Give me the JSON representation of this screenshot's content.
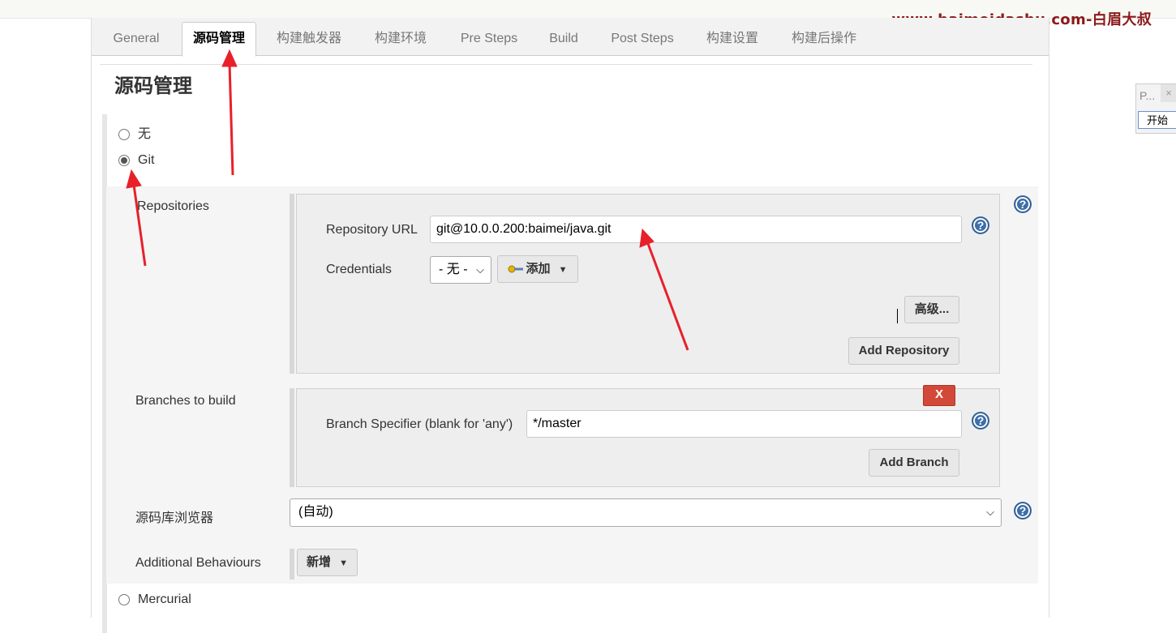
{
  "watermark": "www.baimeidashu.com-白眉大叔",
  "tabs": [
    "General",
    "源码管理",
    "构建触发器",
    "构建环境",
    "Pre Steps",
    "Build",
    "Post Steps",
    "构建设置",
    "构建后操作"
  ],
  "active_tab_index": 1,
  "section_title": "源码管理",
  "scm_options": {
    "none": "无",
    "git": "Git",
    "mercurial": "Mercurial"
  },
  "selected_scm": "Git",
  "repositories": {
    "label": "Repositories",
    "url_label": "Repository URL",
    "url_value": "git@10.0.0.200:baimei/java.git",
    "credentials_label": "Credentials",
    "credentials_value": "- 无 -",
    "add_credentials_label": "添加",
    "advanced_label": "高级...",
    "add_repository_label": "Add Repository"
  },
  "branches": {
    "label": "Branches to build",
    "delete_label": "X",
    "specifier_label": "Branch Specifier (blank for 'any')",
    "specifier_value": "*/master",
    "add_branch_label": "Add Branch"
  },
  "repo_browser": {
    "label": "源码库浏览器",
    "value": "(自动)"
  },
  "additional_behaviours": {
    "label": "Additional Behaviours",
    "add_label": "新增"
  },
  "mini_widget": {
    "title": "P...",
    "close": "×",
    "start": "开始"
  },
  "icons": {
    "help": "help-icon",
    "key": "key-icon",
    "dropdown": "caret-down-icon"
  },
  "colors": {
    "annotation_arrow": "#e8202a",
    "delete_button": "#d24939",
    "help_icon": "#3d6ea8",
    "watermark": "#8b1a1a"
  }
}
